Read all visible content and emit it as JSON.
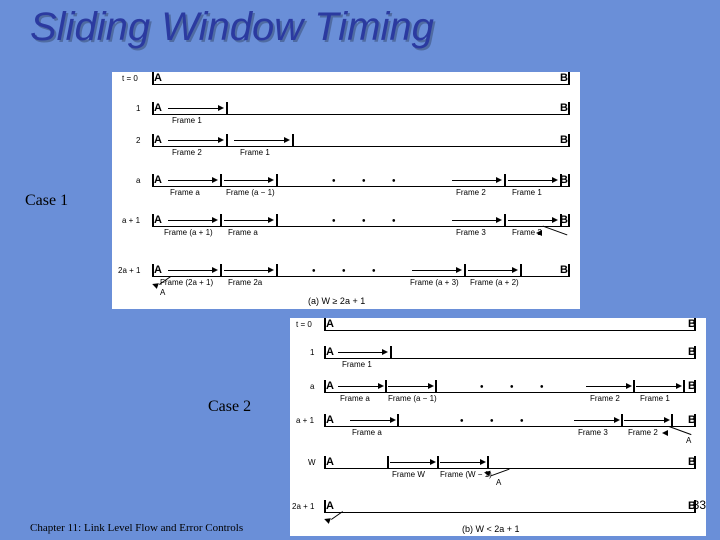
{
  "title": "Sliding Window Timing",
  "case1_label": "Case 1",
  "case2_label": "Case 2",
  "footer": "Chapter 11: Link Level Flow and Error Controls",
  "page_number": "33",
  "diagram1": {
    "rows": [
      {
        "t": "t = 0",
        "left": "A",
        "right": "B",
        "labels": []
      },
      {
        "t": "1",
        "left": "A",
        "right": "B",
        "labels": [
          "Frame 1"
        ]
      },
      {
        "t": "2",
        "left": "A",
        "right": "B",
        "labels": [
          "Frame 2",
          "Frame 1"
        ]
      },
      {
        "t": "a",
        "left": "A",
        "right": "B",
        "labels": [
          "Frame a",
          "Frame (a − 1)",
          "Frame 2",
          "Frame 1"
        ]
      },
      {
        "t": "a + 1",
        "left": "A",
        "right": "B",
        "labels": [
          "Frame (a + 1)",
          "Frame a",
          "Frame 3",
          "Frame 2"
        ]
      },
      {
        "t": "2a + 1",
        "left": "A",
        "right": "B",
        "labels": [
          "Frame (2a + 1)",
          "Frame 2a",
          "Frame (a + 3)",
          "Frame (a + 2)"
        ]
      }
    ],
    "ack_label": "A",
    "caption": "(a) W ≥ 2a + 1"
  },
  "diagram2": {
    "rows": [
      {
        "t": "t = 0",
        "left": "A",
        "right": "B",
        "labels": []
      },
      {
        "t": "1",
        "left": "A",
        "right": "B",
        "labels": [
          "Frame 1"
        ]
      },
      {
        "t": "a",
        "left": "A",
        "right": "B",
        "labels": [
          "Frame a",
          "Frame (a − 1)",
          "Frame 2",
          "Frame 1"
        ]
      },
      {
        "t": "a + 1",
        "left": "A",
        "right": "B",
        "labels": [
          "Frame a",
          "Frame 3",
          "Frame 2"
        ]
      },
      {
        "t": "W",
        "left": "A",
        "right": "B",
        "labels": [
          "Frame W",
          "Frame (W − 1)"
        ]
      },
      {
        "t": "2a + 1",
        "left": "A",
        "right": "B",
        "labels": []
      }
    ],
    "ack_label": "A",
    "caption": "(b) W < 2a + 1"
  }
}
